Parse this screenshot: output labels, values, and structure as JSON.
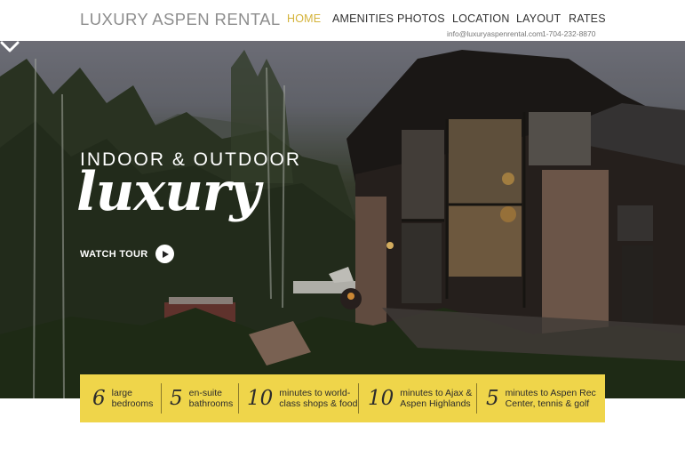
{
  "header": {
    "brand": "LUXURY ASPEN RENTAL",
    "nav": [
      {
        "label": "HOME",
        "active": true
      },
      {
        "label": "AMENITIES",
        "active": false
      },
      {
        "label": "PHOTOS",
        "active": false
      },
      {
        "label": "LOCATION",
        "active": false
      },
      {
        "label": "LAYOUT",
        "active": false
      },
      {
        "label": "RATES",
        "active": false
      }
    ],
    "email": "info@luxuryaspenrental.com",
    "phone": "1-704-232-8870"
  },
  "hero": {
    "kicker": "INDOOR & OUTDOOR",
    "script": "luxury",
    "watch_label": "WATCH TOUR",
    "play_icon": "play-icon",
    "scroll_icon": "chevron-down-icon"
  },
  "stats": [
    {
      "number": "6",
      "label": "large\nbedrooms"
    },
    {
      "number": "5",
      "label": "en-suite\nbathrooms"
    },
    {
      "number": "10",
      "label": "minutes to world-\nclass shops & food"
    },
    {
      "number": "10",
      "label": "minutes to Ajax &\nAspen Highlands"
    },
    {
      "number": "5",
      "label": "minutes to Aspen Rec\nCenter, tennis & golf"
    }
  ],
  "colors": {
    "accent": "#d4b33a",
    "stats_bar": "#efd54a",
    "brand_text": "#8d8d8d"
  }
}
